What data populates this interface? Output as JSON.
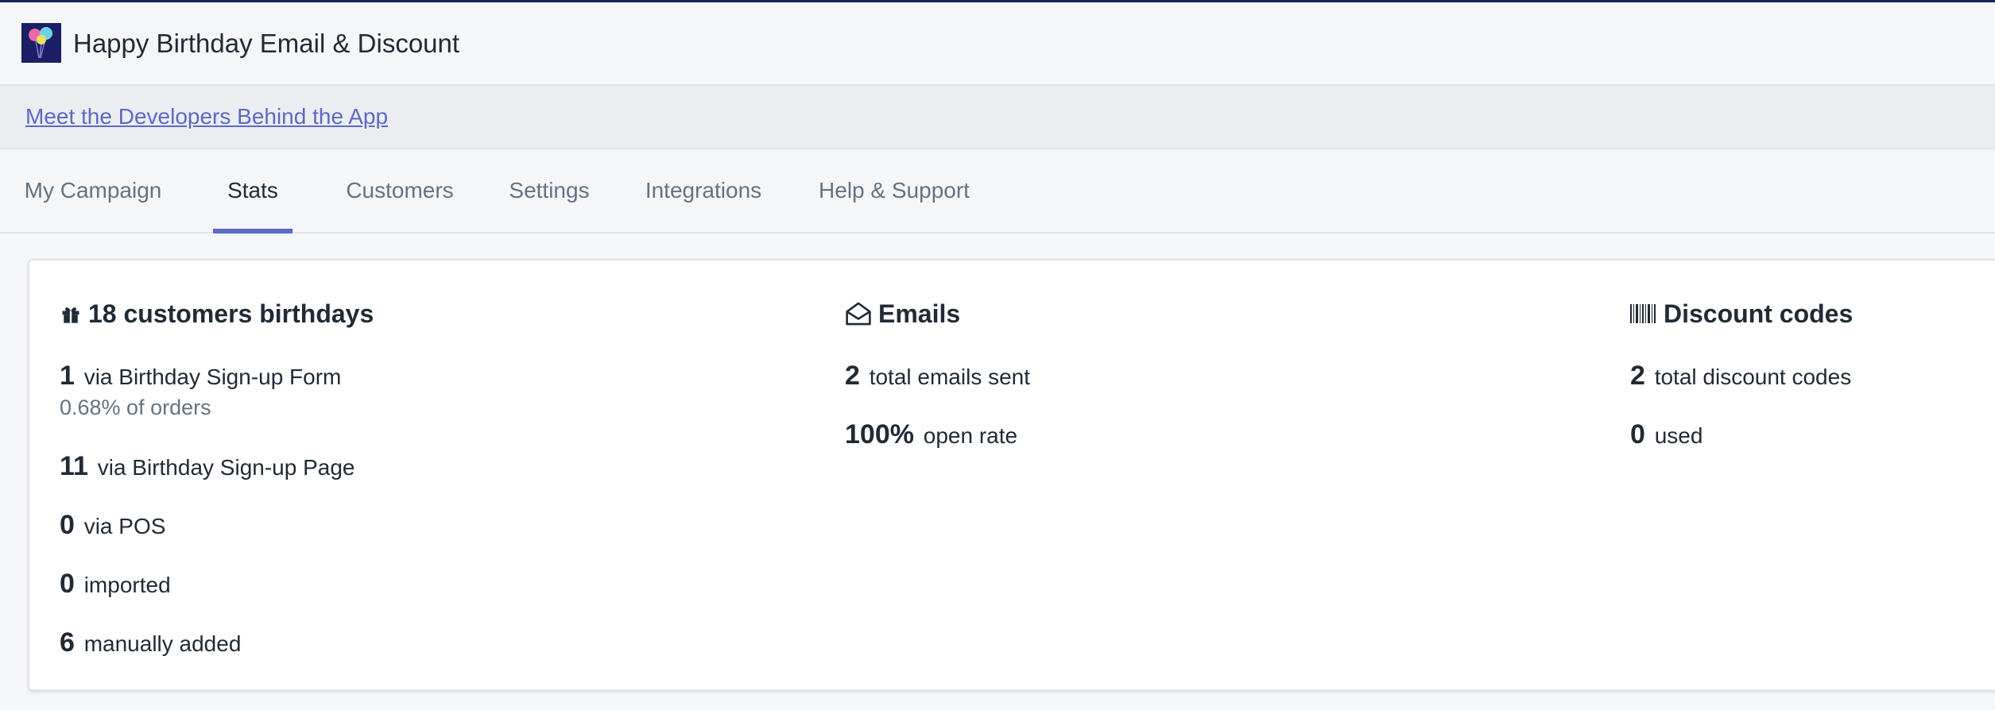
{
  "app": {
    "title": "Happy Birthday Email & Discount"
  },
  "banner": {
    "link_text": "Meet the Developers Behind the App"
  },
  "tabs": [
    {
      "label": "My Campaign",
      "active": false
    },
    {
      "label": "Stats",
      "active": true
    },
    {
      "label": "Customers",
      "active": false
    },
    {
      "label": "Settings",
      "active": false
    },
    {
      "label": "Integrations",
      "active": false
    },
    {
      "label": "Help & Support",
      "active": false
    }
  ],
  "stats": {
    "birthdays": {
      "title": "18 customers birthdays",
      "icon": "gift-icon",
      "items": [
        {
          "value": "1",
          "label": "via Birthday Sign-up Form",
          "sub": "0.68% of orders"
        },
        {
          "value": "11",
          "label": "via Birthday Sign-up Page"
        },
        {
          "value": "0",
          "label": "via POS"
        },
        {
          "value": "0",
          "label": "imported"
        },
        {
          "value": "6",
          "label": "manually added"
        }
      ]
    },
    "emails": {
      "title": "Emails",
      "icon": "envelope-open-icon",
      "items": [
        {
          "value": "2",
          "label": "total emails sent"
        },
        {
          "value": "100%",
          "label": "open rate"
        }
      ]
    },
    "discounts": {
      "title": "Discount codes",
      "icon": "barcode-icon",
      "items": [
        {
          "value": "2",
          "label": "total discount codes"
        },
        {
          "value": "0",
          "label": "used"
        }
      ]
    }
  },
  "colors": {
    "accent": "#5c6ac4",
    "header_bar": "#1c2260",
    "text": "#212b36",
    "muted": "#637381"
  }
}
